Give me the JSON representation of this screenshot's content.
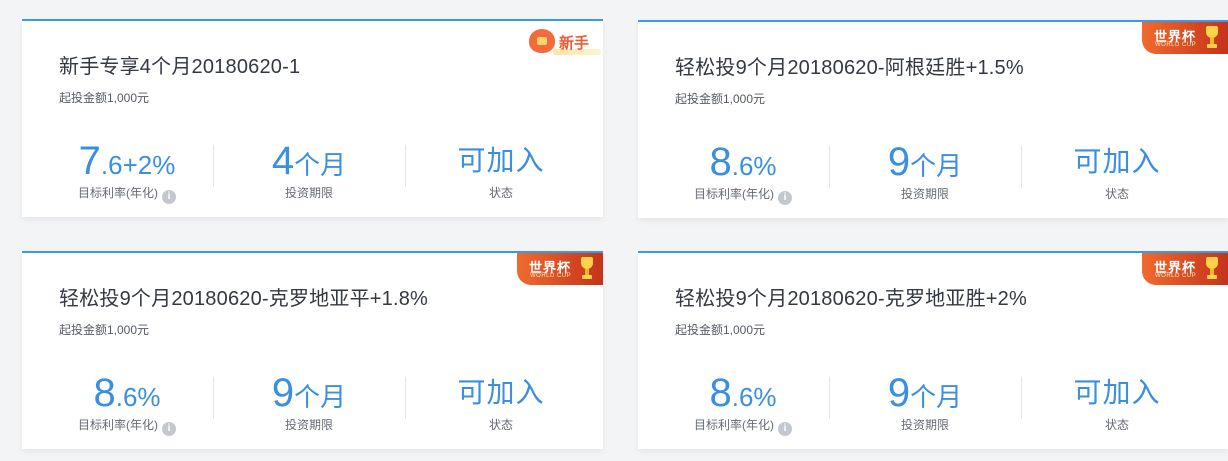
{
  "products": [
    {
      "title": "新手专享4个月20180620-1",
      "min_invest": "起投金额1,000元",
      "rate_main": "7",
      "rate_suffix": ".6+2%",
      "rate_label": "目标利率(年化)",
      "term_value": "4",
      "term_unit": "个月",
      "term_label": "投资期限",
      "status_value": "可加入",
      "status_label": "状态",
      "badge": {
        "type": "new",
        "text": "新手"
      }
    },
    {
      "title": "轻松投9个月20180620-阿根廷胜+1.5%",
      "min_invest": "起投金额1,000元",
      "rate_main": "8",
      "rate_suffix": ".6%",
      "rate_label": "目标利率(年化)",
      "term_value": "9",
      "term_unit": "个月",
      "term_label": "投资期限",
      "status_value": "可加入",
      "status_label": "状态",
      "badge": {
        "type": "worldcup",
        "text": "世界杯",
        "subtext": "WORLD CUP"
      }
    },
    {
      "title": "轻松投9个月20180620-克罗地亚平+1.8%",
      "min_invest": "起投金额1,000元",
      "rate_main": "8",
      "rate_suffix": ".6%",
      "rate_label": "目标利率(年化)",
      "term_value": "9",
      "term_unit": "个月",
      "term_label": "投资期限",
      "status_value": "可加入",
      "status_label": "状态",
      "badge": {
        "type": "worldcup",
        "text": "世界杯",
        "subtext": "WORLD CUP"
      }
    },
    {
      "title": "轻松投9个月20180620-克罗地亚胜+2%",
      "min_invest": "起投金额1,000元",
      "rate_main": "8",
      "rate_suffix": ".6%",
      "rate_label": "目标利率(年化)",
      "term_value": "9",
      "term_unit": "个月",
      "term_label": "投资期限",
      "status_value": "可加入",
      "status_label": "状态",
      "badge": {
        "type": "worldcup",
        "text": "世界杯",
        "subtext": "WORLD CUP"
      }
    }
  ],
  "info_icon_glyph": "i",
  "colors": {
    "accent": "#3a8fe0",
    "border_top": "#3a9ae8",
    "badge_orange": "#f06a2e",
    "badge_red": "#c4331b"
  }
}
